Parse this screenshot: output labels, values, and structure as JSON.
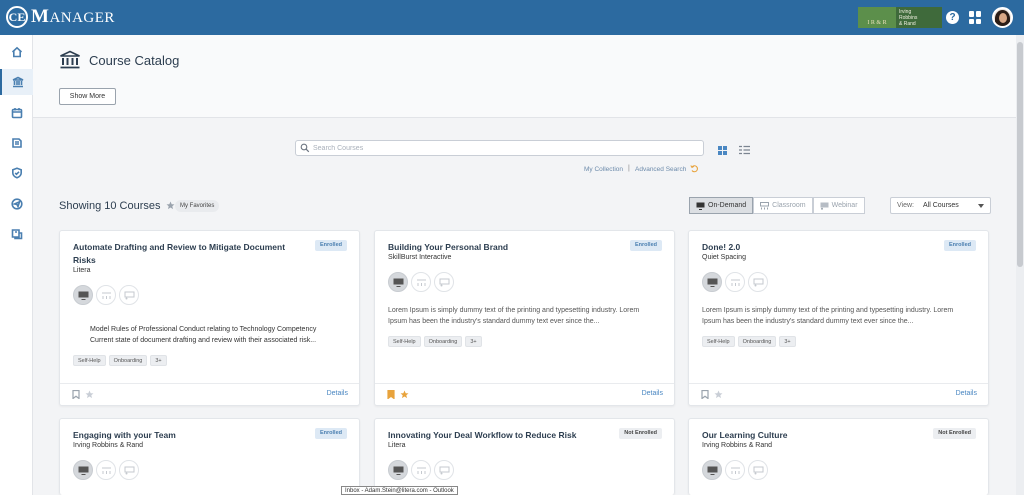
{
  "app": {
    "logo_mark": "CE",
    "logo_text_first": "M",
    "logo_text_rest": "ANAGER",
    "org_mark": "I R & R",
    "org_name": "Irving\nRobbins\n& Rand",
    "help_label": "?"
  },
  "sidebar": {
    "items": [
      {
        "name": "home-icon"
      },
      {
        "name": "catalog-icon",
        "active": true
      },
      {
        "name": "calendar-icon"
      },
      {
        "name": "transcript-icon"
      },
      {
        "name": "compliance-shield-icon"
      },
      {
        "name": "send-icon"
      },
      {
        "name": "certificate-icon"
      }
    ]
  },
  "page": {
    "title": "Course Catalog",
    "show_more_label": "Show More"
  },
  "search": {
    "placeholder": "Search Courses",
    "value": "",
    "my_collection": "My Collection",
    "separator": "|",
    "advanced_search": "Advanced Search"
  },
  "toolbar": {
    "showing_text": "Showing 10 Courses",
    "favorites_label": "My Favorites",
    "types": [
      {
        "label": "On-Demand",
        "active": true
      },
      {
        "label": "Classroom",
        "active": false
      },
      {
        "label": "Webinar",
        "active": false
      }
    ],
    "view_label": "View:",
    "view_value": "All Courses"
  },
  "courses": [
    {
      "title": "Automate Drafting and Review to Mitigate Document Risks",
      "provider": "Litera",
      "status": "Enrolled",
      "status_type": "enrolled",
      "formats": {
        "on_demand": true,
        "classroom": false,
        "webinar": false
      },
      "bullets": [
        "Model Rules of Professional Conduct relating to Technology Competency",
        "Current state of document drafting and review with their associated risk..."
      ],
      "tags": [
        "Self-Help",
        "Onboarding",
        "3+"
      ],
      "bookmarked": false,
      "favorited": false,
      "details_label": "Details"
    },
    {
      "title": "Building Your Personal Brand",
      "provider": "SkillBurst Interactive",
      "status": "Enrolled",
      "status_type": "enrolled",
      "formats": {
        "on_demand": true,
        "classroom": false,
        "webinar": false
      },
      "description": "Lorem Ipsum is simply dummy text of the printing and typesetting industry. Lorem Ipsum has been the industry's standard dummy text ever since the...",
      "tags": [
        "Self-Help",
        "Onboarding",
        "3+"
      ],
      "bookmarked": true,
      "favorited": true,
      "details_label": "Details"
    },
    {
      "title": "Done! 2.0",
      "provider": "Quiet Spacing",
      "status": "Enrolled",
      "status_type": "enrolled",
      "formats": {
        "on_demand": true,
        "classroom": false,
        "webinar": false
      },
      "description": "Lorem Ipsum is simply dummy text of the printing and typesetting industry. Lorem Ipsum has been the industry's standard dummy text ever since the...",
      "tags": [
        "Self-Help",
        "Onboarding",
        "3+"
      ],
      "bookmarked": false,
      "favorited": false,
      "details_label": "Details"
    },
    {
      "title": "Engaging with your Team",
      "provider": "Irving Robbins & Rand",
      "status": "Enrolled",
      "status_type": "enrolled",
      "formats": {
        "on_demand": true,
        "classroom": false,
        "webinar": false
      }
    },
    {
      "title": "Innovating Your Deal Workflow to Reduce Risk",
      "provider": "Litera",
      "status": "Not Enrolled",
      "status_type": "not",
      "formats": {
        "on_demand": true,
        "classroom": false,
        "webinar": false
      }
    },
    {
      "title": "Our Learning Culture",
      "provider": "Irving Robbins & Rand",
      "status": "Not Enrolled",
      "status_type": "not",
      "formats": {
        "on_demand": true,
        "classroom": false,
        "webinar": false
      }
    }
  ],
  "taskbar_tooltip": "Inbox - Adam.Stein@litera.com - Outlook",
  "colors": {
    "header": "#2c6aa0",
    "accent": "#4a87c2",
    "bookmark_active": "#e8a33c"
  }
}
